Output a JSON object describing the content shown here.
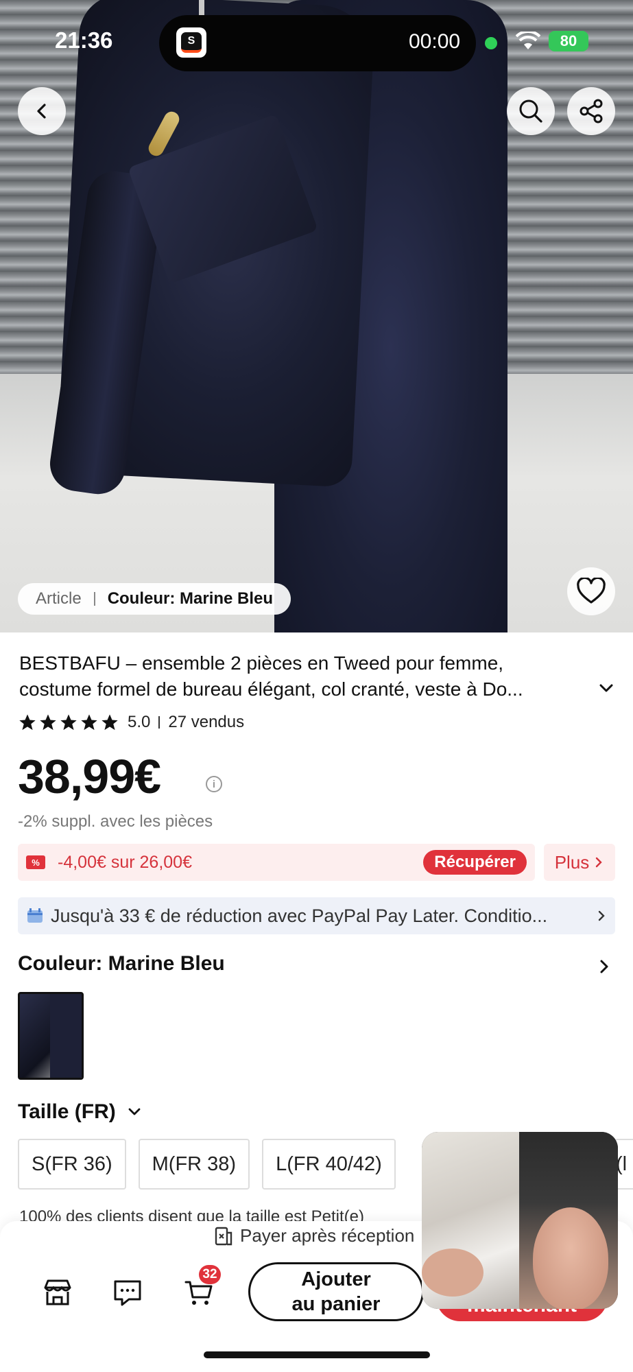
{
  "status_bar": {
    "time": "21:36",
    "island_app_letter": "S",
    "recording_timer": "00:00",
    "battery": "80"
  },
  "hero": {
    "article_label": "Article",
    "color_chip": "Couleur: Marine Bleu"
  },
  "product": {
    "title_line1": "BESTBAFU – ensemble 2 pièces en Tweed pour femme,",
    "title_line2": "costume formel de bureau élégant, col cranté, veste à Do...",
    "rating": "5.0",
    "sold": "27 vendus",
    "price": "38,99€",
    "extra_discount": "-2% suppl. avec les pièces",
    "coupon_text": "-4,00€ sur 26,00€",
    "coupon_button": "Récupérer",
    "more_button": "Plus",
    "paypal_text": "Jusqu'à 33 € de réduction avec PayPal Pay Later. Conditio..."
  },
  "color": {
    "label": "Couleur: Marine Bleu",
    "selected_swatch": "Marine Bleu"
  },
  "size": {
    "label": "Taille (FR)",
    "options": [
      "S(FR 36)",
      "M(FR 38)",
      "L(FR 40/42)"
    ],
    "partial_option": "(l",
    "note": "100% des clients disent que la taille est Petit(e)"
  },
  "bottom_bar": {
    "pay_after": "Payer après réception",
    "cart_count": "32",
    "add_to_cart_line1": "Ajouter",
    "add_to_cart_line2": "au panier",
    "buy_now": "maintenant"
  },
  "colors": {
    "accent_red": "#e0323b",
    "coupon_bg": "#fdeeee",
    "paypal_bg": "#eef1f8",
    "battery_green": "#34c759"
  },
  "icons": [
    "back-icon",
    "search-icon",
    "share-icon",
    "heart-icon",
    "star-icon",
    "chevron-down-icon",
    "chevron-right-icon",
    "info-icon",
    "coupon-icon",
    "paypal-icon",
    "payment-icon",
    "store-icon",
    "chat-icon",
    "cart-icon",
    "wifi-icon"
  ]
}
